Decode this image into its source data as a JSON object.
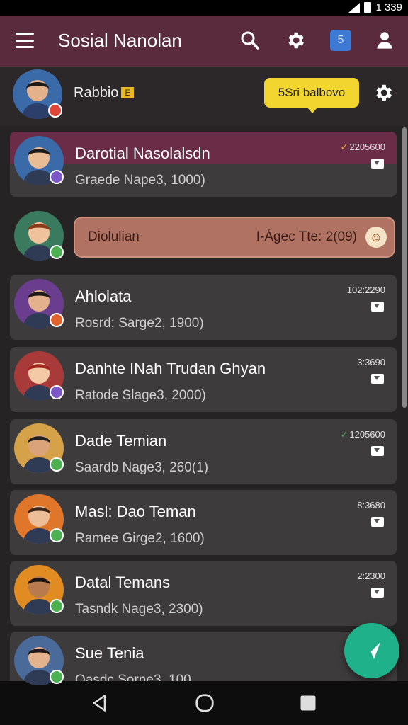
{
  "status_bar": {
    "time": "1 339"
  },
  "app_bar": {
    "title": "Sosial Nanolan",
    "icons": [
      "menu-icon",
      "search-icon",
      "gear-icon",
      "app-badge-icon",
      "person-icon"
    ],
    "badge_glyph": "5",
    "colors": {
      "background": "#5a2a3d"
    }
  },
  "profile": {
    "name": "Rabbio",
    "badge_glyph": "E",
    "tooltip": "5Sri balbovo"
  },
  "contacts": [
    {
      "name": "Darotial Nasolalsdn",
      "subtitle": "Graede Nape3, 1000)",
      "time": "2205600",
      "tick": "yellow",
      "highlight": true,
      "status_color": "#7b57c8",
      "avatar_bg": "#3a6aa8",
      "skin": "#e8bc95",
      "hair": "#1e1a17"
    },
    {
      "name": "Diolulian",
      "info": "I-Ágec Tte: 2(09)",
      "pill": true,
      "status_color": "#4caf50",
      "avatar_bg": "#3a7a5f",
      "skin": "#f0c29b",
      "hair": "#8a3a18"
    },
    {
      "name": "Ahlolata",
      "subtitle": "Rosrd; Sarge2, 1900)",
      "time": "102:2290",
      "status_color": "#e0622c",
      "avatar_bg": "#6a3d8e",
      "skin": "#e3b18c",
      "hair": "#1e1a17"
    },
    {
      "name": "Danhte INah  Trudan Ghyan",
      "subtitle": "Ratode Slage3, 2000)",
      "time": "3:3690",
      "status_color": "#7b57c8",
      "avatar_bg": "#a93a3a",
      "skin": "#f4c9a5",
      "hair": "#a3251f"
    },
    {
      "name": "Dade Temian",
      "subtitle": "Saardb Nage3, 260(1)",
      "time": "1205600",
      "tick": "green",
      "status_color": "#4caf50",
      "avatar_bg": "#d5a24a",
      "skin": "#dba37a",
      "hair": "#22201f"
    },
    {
      "name": "Masl: Dao Teman",
      "subtitle": "Ramee Girge2, 1600)",
      "time": "8:3680",
      "status_color": "#4caf50",
      "avatar_bg": "#e0762a",
      "skin": "#edbd98",
      "hair": "#3a251a"
    },
    {
      "name": "Datal Temans",
      "subtitle": "Tasndk Nage3, 2300)",
      "time": "2:2300",
      "status_color": "#4caf50",
      "avatar_bg": "#e08c22",
      "skin": "#b97a4e",
      "hair": "#1a1512"
    },
    {
      "name": "Sue Tenia",
      "subtitle": "Oasdc Sorne3, 100",
      "time": "",
      "status_color": "#4caf50",
      "avatar_bg": "#4a6a9a",
      "skin": "#e4b28c",
      "hair": "#1e1a17"
    }
  ],
  "fab": {
    "icon": "compose-icon",
    "color": "#1fb28a"
  },
  "nav_bar": {
    "icons": [
      "back-icon",
      "home-icon",
      "recents-icon"
    ]
  }
}
